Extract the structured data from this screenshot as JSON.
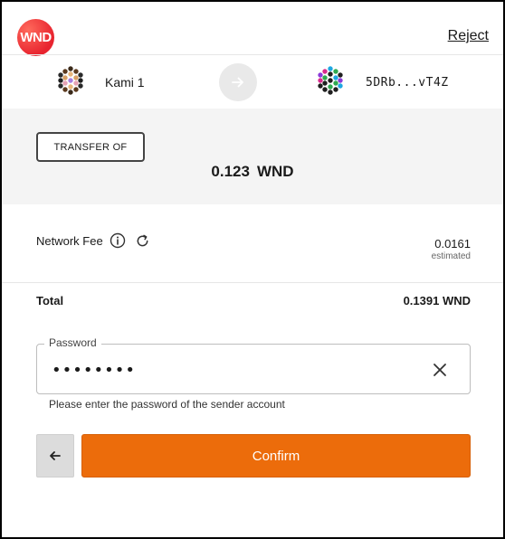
{
  "header": {
    "logo_text": "WND",
    "reject_label": "Reject"
  },
  "accounts": {
    "from_name": "Kami 1",
    "to_address": "5DRb...vT4Z"
  },
  "transfer": {
    "badge_label": "TRANSFER OF",
    "amount_value": "0.123",
    "amount_unit": "WND"
  },
  "fee": {
    "label": "Network Fee",
    "value": "0.0161",
    "note": "estimated"
  },
  "total": {
    "label": "Total",
    "value": "0.1391 WND"
  },
  "password": {
    "legend": "Password",
    "value": "password",
    "help": "Please enter the password of the sender account"
  },
  "actions": {
    "confirm_label": "Confirm"
  },
  "colors": {
    "accent": "#ec6c0b",
    "logo": "#e8242f",
    "panel_bg": "#f4f4f4"
  },
  "icons": {
    "info": "info-icon",
    "refresh": "refresh-icon",
    "clear": "close-icon",
    "back": "arrow-left-icon",
    "arrow": "arrow-right-icon"
  }
}
